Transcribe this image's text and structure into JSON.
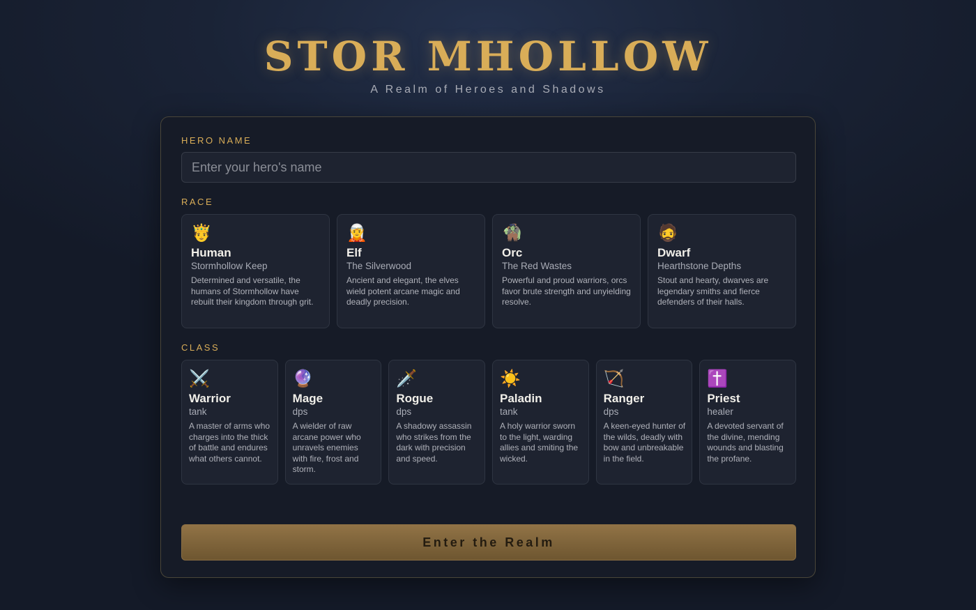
{
  "header": {
    "title": "STORMHOLLOW",
    "title_display": "STOR MHOLLOW",
    "subtitle": "A Realm of Heroes and Shadows"
  },
  "form": {
    "hero_name_label": "HERO NAME",
    "hero_name_placeholder": "Enter your hero's name",
    "hero_name_value": "",
    "race_label": "RACE",
    "class_label": "CLASS",
    "races": [
      {
        "icon": "🤴",
        "icon_name": "prince-icon",
        "name": "Human",
        "origin": "Stormhollow Keep",
        "description": "Determined and versatile, the humans of Stormhollow have rebuilt their kingdom through grit."
      },
      {
        "icon": "🧝",
        "icon_name": "elf-icon",
        "name": "Elf",
        "origin": "The Silverwood",
        "description": "Ancient and elegant, the elves wield potent arcane magic and deadly precision."
      },
      {
        "icon": "🧌",
        "icon_name": "troll-icon",
        "name": "Orc",
        "origin": "The Red Wastes",
        "description": "Powerful and proud warriors, orcs favor brute strength and unyielding resolve."
      },
      {
        "icon": "🧔",
        "icon_name": "bearded-man-icon",
        "name": "Dwarf",
        "origin": "Hearthstone Depths",
        "description": "Stout and hearty, dwarves are legendary smiths and fierce defenders of their halls."
      }
    ],
    "classes": [
      {
        "icon": "⚔️",
        "icon_name": "crossed-swords-icon",
        "name": "Warrior",
        "role": "tank",
        "description": "A master of arms who charges into the thick of battle and endures what others cannot."
      },
      {
        "icon": "🔮",
        "icon_name": "crystal-ball-icon",
        "name": "Mage",
        "role": "dps",
        "description": "A wielder of raw arcane power who unravels enemies with fire, frost and storm."
      },
      {
        "icon": "🗡️",
        "icon_name": "dagger-icon",
        "name": "Rogue",
        "role": "dps",
        "description": "A shadowy assassin who strikes from the dark with precision and speed."
      },
      {
        "icon": "☀️",
        "icon_name": "sun-icon",
        "name": "Paladin",
        "role": "tank",
        "description": "A holy warrior sworn to the light, warding allies and smiting the wicked."
      },
      {
        "icon": "🏹",
        "icon_name": "bow-and-arrow-icon",
        "name": "Ranger",
        "role": "dps",
        "description": "A keen-eyed hunter of the wilds, deadly with bow and unbreakable in the field."
      },
      {
        "icon": "✝️",
        "icon_name": "latin-cross-icon",
        "name": "Priest",
        "role": "healer",
        "description": "A devoted servant of the divine, mending wounds and blasting the profane."
      }
    ],
    "submit_label": "Enter the Realm"
  },
  "colors": {
    "accent_gold": "#d9ad58",
    "panel_bg": "#161b27",
    "card_bg": "#1e2330",
    "button_gold": "#917346"
  }
}
